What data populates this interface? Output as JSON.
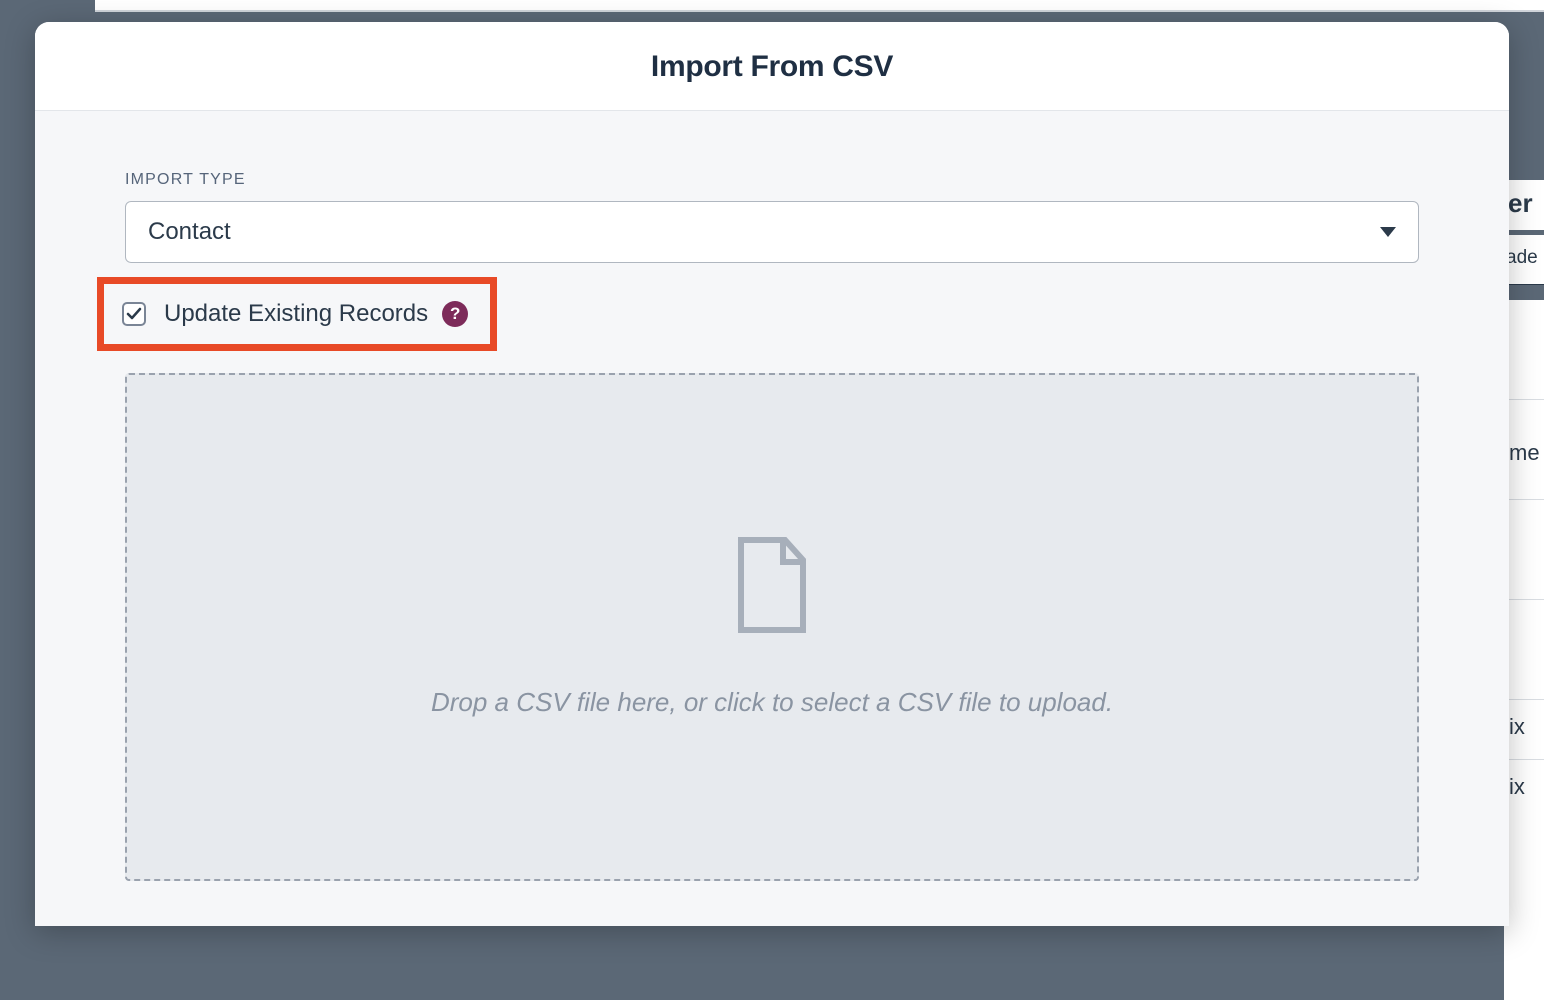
{
  "modal": {
    "title": "Import From CSV",
    "importTypeLabel": "IMPORT TYPE",
    "importTypeValue": "Contact",
    "updateExistingLabel": "Update Existing Records",
    "updateExistingChecked": true,
    "helpSymbol": "?",
    "dropzoneText": "Drop a CSV file here, or click to select a CSV file to upload."
  },
  "background": {
    "headerFrag": "er",
    "subheaderFrag": "ade",
    "rowFrags": [
      "",
      "me",
      "",
      "",
      "ix",
      "ix"
    ]
  },
  "colors": {
    "highlight": "#e84a27",
    "helpBadge": "#7d2b5a",
    "textPrimary": "#1f2f43",
    "bodyBg": "#f6f7f9",
    "dropzoneBg": "#e7eaee"
  }
}
